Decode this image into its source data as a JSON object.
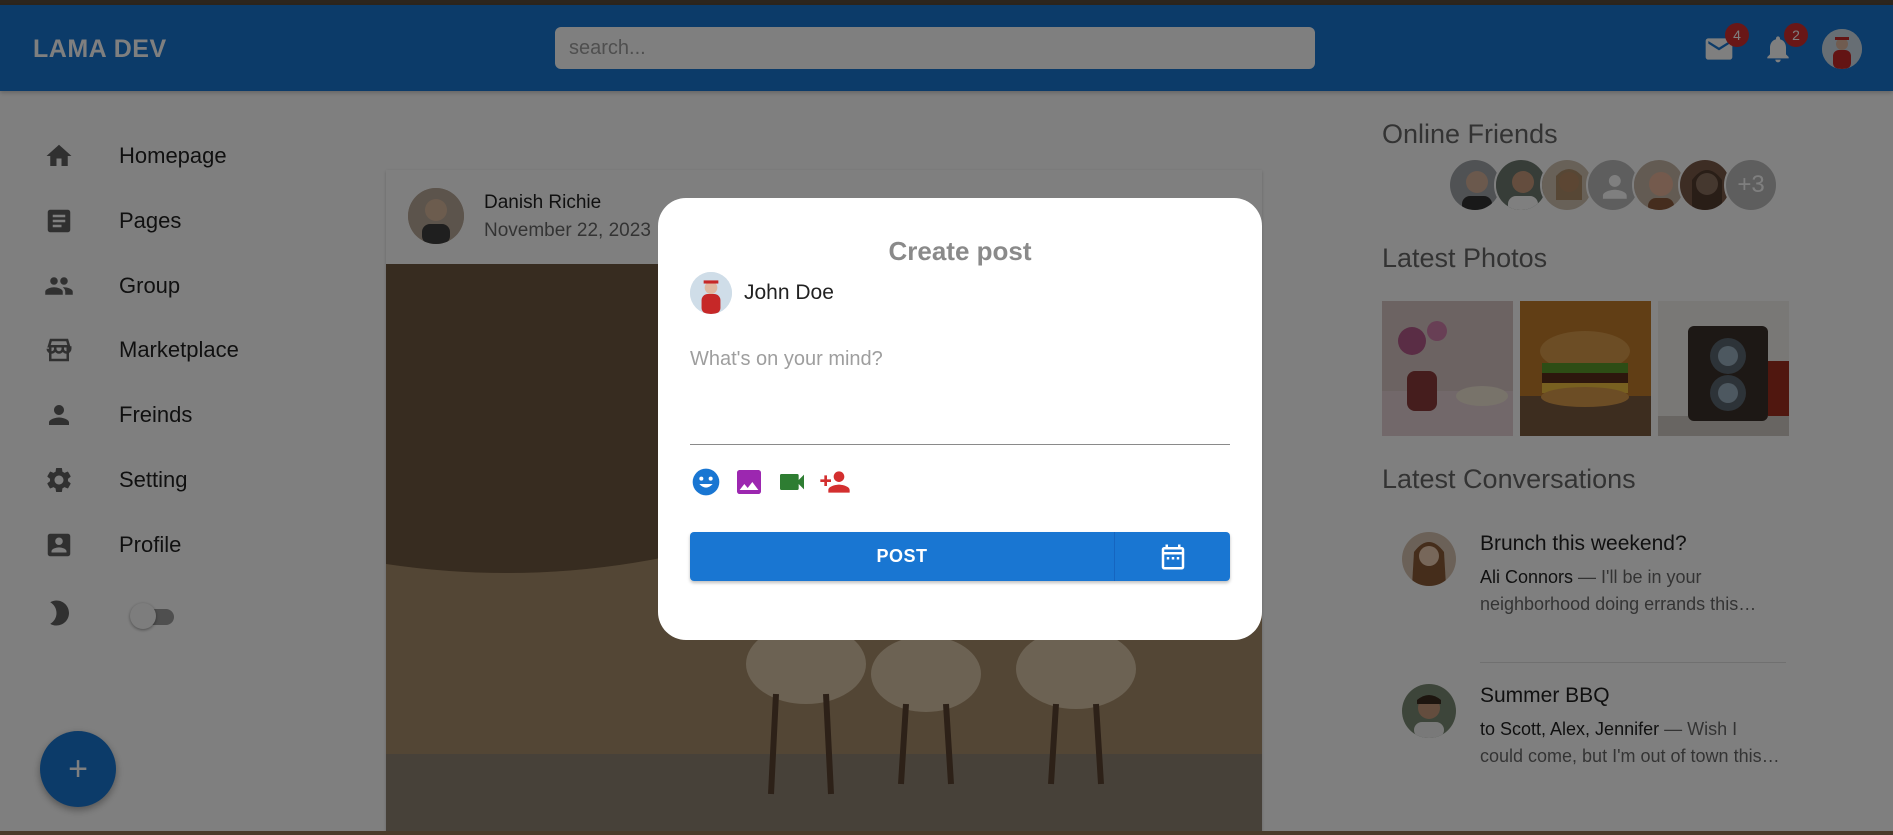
{
  "header": {
    "logo": "LAMA DEV",
    "search_placeholder": "search...",
    "mail_badge": "4",
    "notifications_badge": "2"
  },
  "sidebar": {
    "items": [
      {
        "label": "Homepage",
        "icon": "home-icon"
      },
      {
        "label": "Pages",
        "icon": "article-icon"
      },
      {
        "label": "Group",
        "icon": "group-icon"
      },
      {
        "label": "Marketplace",
        "icon": "storefront-icon"
      },
      {
        "label": "Freinds",
        "icon": "person-icon"
      },
      {
        "label": "Setting",
        "icon": "settings-icon"
      },
      {
        "label": "Profile",
        "icon": "account-box-icon"
      }
    ],
    "dark_mode_icon": "moon-icon",
    "fab_label": "+"
  },
  "feed": {
    "post": {
      "author": "Danish Richie",
      "date": "November 22, 2023"
    }
  },
  "rightbar": {
    "online_title": "Online Friends",
    "online_more": "+3",
    "photos_title": "Latest Photos",
    "conversations_title": "Latest Conversations",
    "conversations": [
      {
        "title": "Brunch this weekend?",
        "sender": "Ali Connors",
        "text": " — I'll be in your neighborhood doing errands this…"
      },
      {
        "title": "Summer BBQ",
        "sender": "to Scott, Alex, Jennifer",
        "text": " — Wish I could come, but I'm out of town this…"
      }
    ]
  },
  "modal": {
    "title": "Create post",
    "user_name": "John Doe",
    "placeholder": "What's on your mind?",
    "post_button": "POST",
    "colors": {
      "emoji": "#1976d2",
      "image": "#9c27b0",
      "video": "#2e7d32",
      "person_add": "#d32f2f"
    }
  }
}
